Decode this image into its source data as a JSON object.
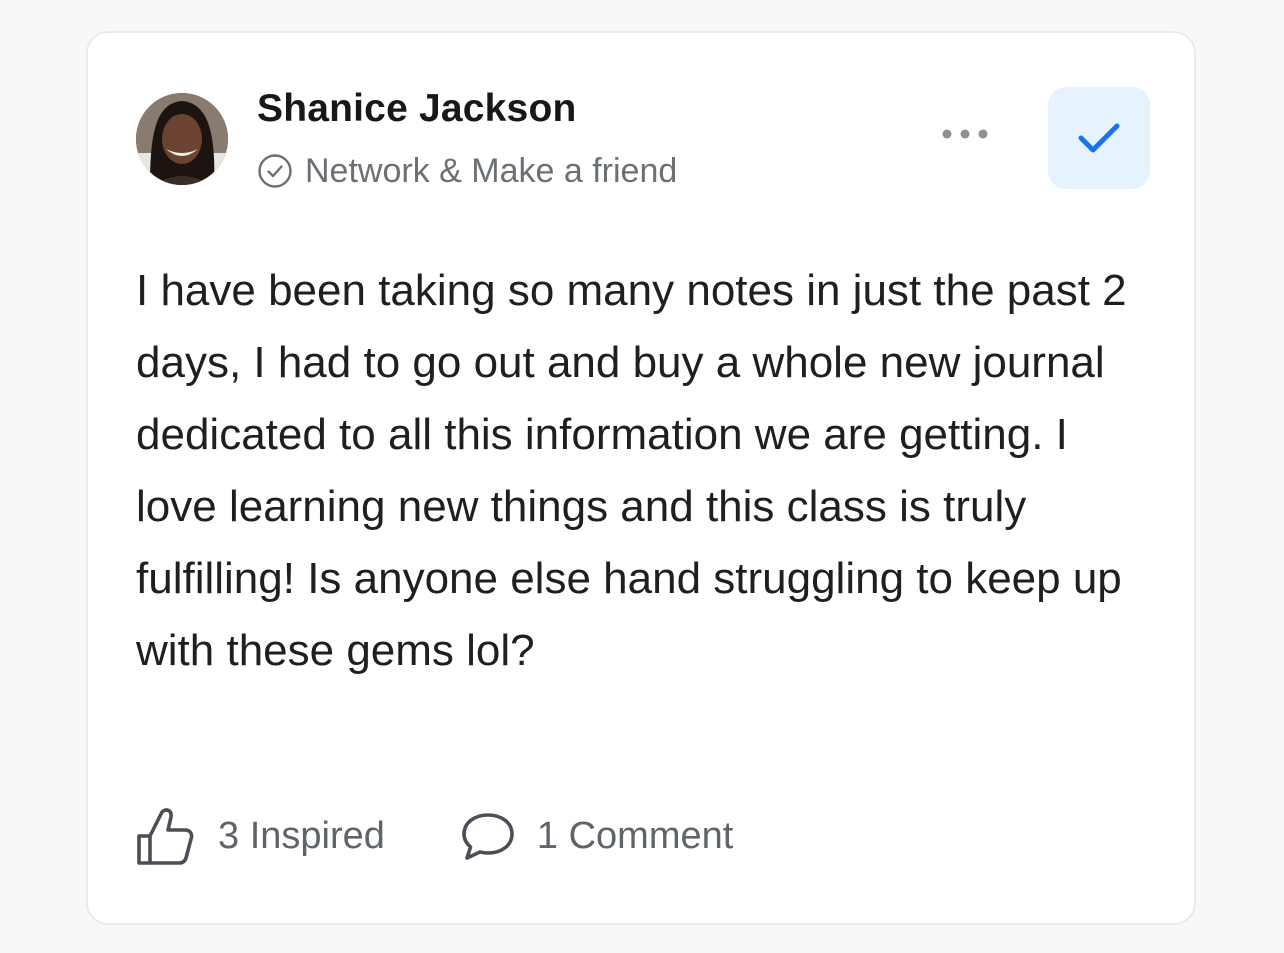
{
  "post": {
    "author": {
      "name": "Shanice Jackson",
      "avatar_icon": "avatar-photo"
    },
    "group": {
      "icon": "check-circle-icon",
      "label": "Network & Make a friend"
    },
    "menu_icon": "more-horizontal-icon",
    "status_icon": "checkmark-icon",
    "body": "I have been taking so many notes in just the past 2 days, I had to go out and buy a whole new journal dedicated to all this information we are getting. I love learning new things and this class is truly fulfilling! Is anyone else hand struggling to keep up with these gems lol?",
    "actions": {
      "inspired": {
        "icon": "thumbs-up-icon",
        "label": "3 Inspired"
      },
      "comments": {
        "icon": "comment-bubble-icon",
        "label": "1 Comment"
      }
    }
  },
  "colors": {
    "accent": "#1a73e8",
    "accent_bg": "#e6f2fd",
    "text_primary": "#16191c",
    "text_secondary": "#6b7075"
  }
}
